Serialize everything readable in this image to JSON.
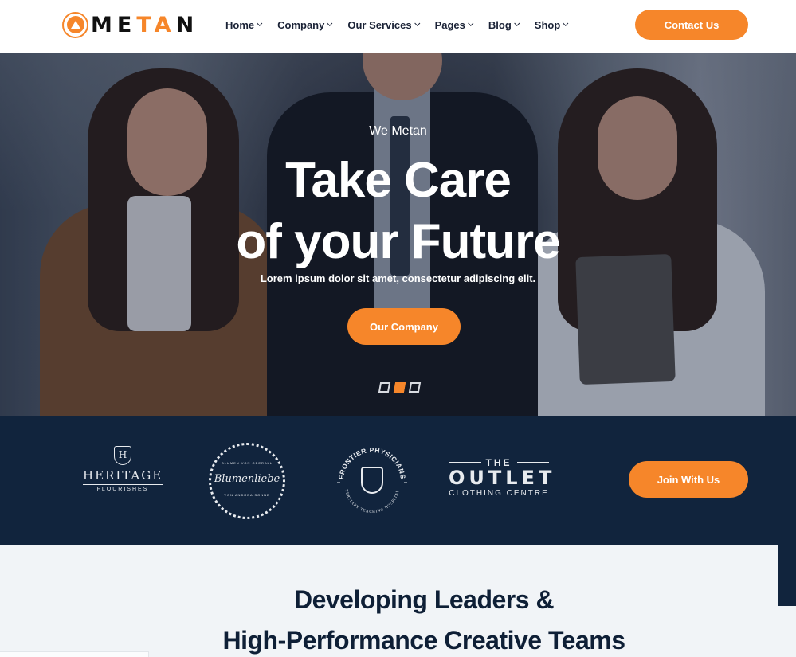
{
  "header": {
    "logo": {
      "prefix_icon": "logo-circle-icon",
      "text_letters": [
        "M",
        "E",
        "T",
        "A",
        "N"
      ],
      "accent_letters": [
        "T",
        "A"
      ]
    },
    "nav": [
      {
        "label": "Home",
        "icon": "chevron-down-icon"
      },
      {
        "label": "Company",
        "icon": "chevron-down-icon"
      },
      {
        "label": "Our Services",
        "icon": "chevron-down-icon"
      },
      {
        "label": "Pages",
        "icon": "chevron-down-icon"
      },
      {
        "label": "Blog",
        "icon": "chevron-down-icon"
      },
      {
        "label": "Shop",
        "icon": "chevron-down-icon"
      }
    ],
    "cta_label": "Contact Us"
  },
  "hero": {
    "kicker": "We Metan",
    "title_line1": "Take Care",
    "title_line2": "of your Future",
    "subtitle": "Lorem ipsum dolor sit amet, consectetur adipiscing elit.",
    "button_label": "Our Company",
    "slides": {
      "count": 3,
      "active_index": 1
    }
  },
  "brands": {
    "logos": [
      {
        "name": "HERITAGE",
        "sub": "FLOURISHES",
        "emblem": "H"
      },
      {
        "name": "Blumenliebe",
        "top": "BLUMEN VON OBERALL",
        "bottom": "VON ANDREA SONNE"
      },
      {
        "name": "FRONTIER PHYSICIANS",
        "bottom": "TERTIARY TEACHING HOSPITAL"
      },
      {
        "pre": "THE",
        "name": "OUTLET",
        "sub": "CLOTHING CENTRE"
      }
    ],
    "button_label": "Join With Us"
  },
  "section": {
    "title_line1": "Developing Leaders &",
    "title_line2": "High-Performance Creative Teams"
  },
  "colors": {
    "accent": "#f6862a",
    "navy": "#11243d",
    "heading": "#0e1f36",
    "section_bg": "#f1f4f7"
  }
}
